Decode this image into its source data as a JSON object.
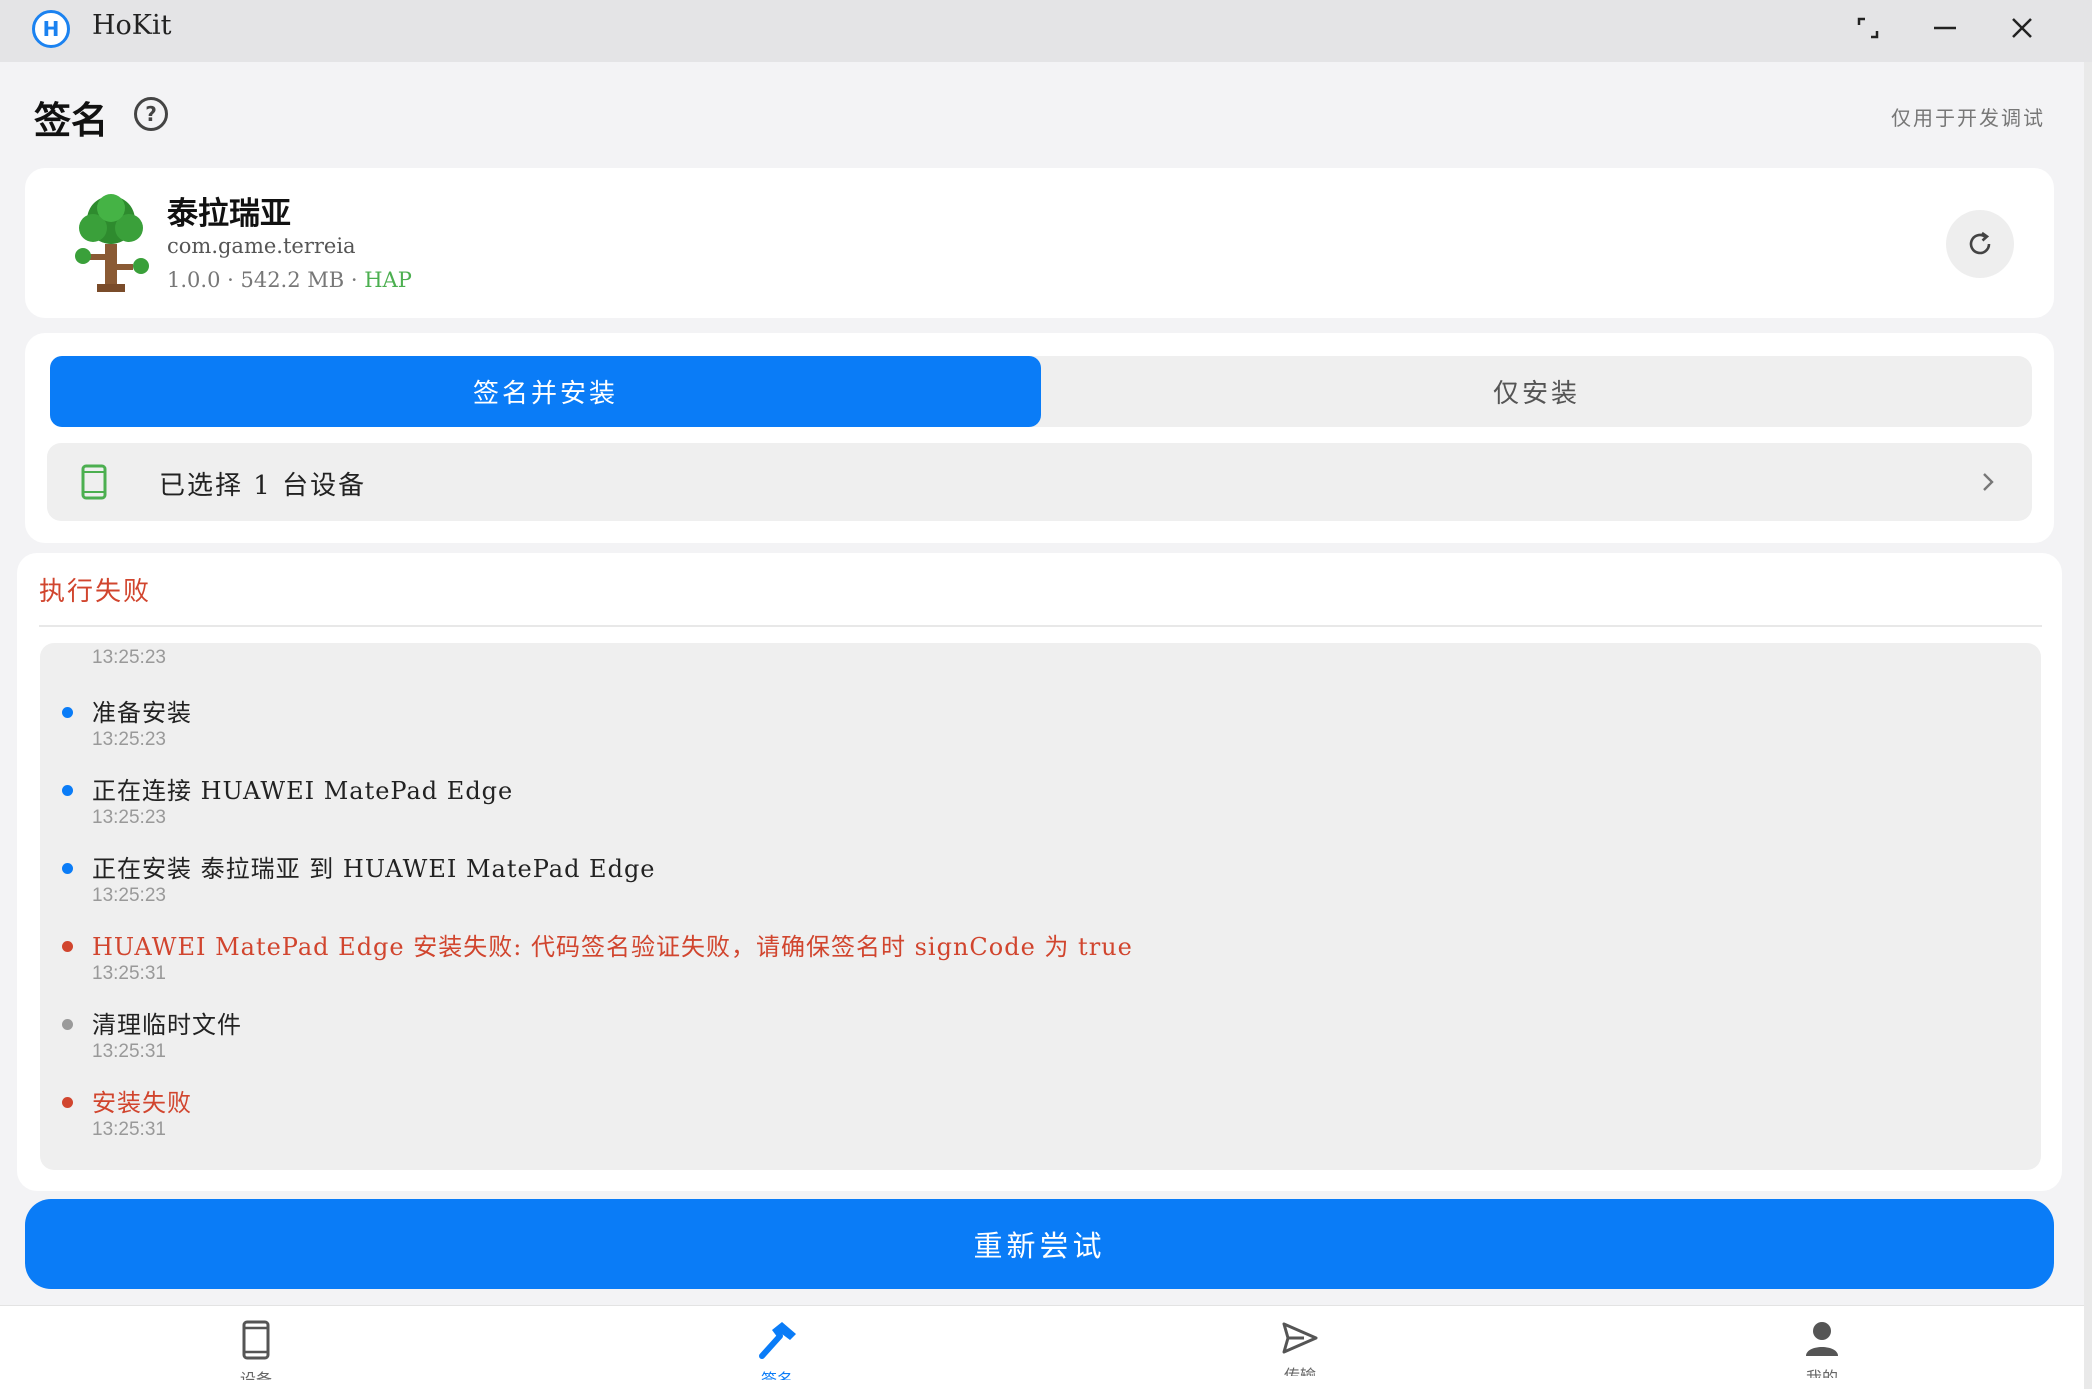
{
  "window": {
    "app_title": "HoKit",
    "logo_letter": "H"
  },
  "header": {
    "title": "签名",
    "help_glyph": "?",
    "dev_note": "仅用于开发调试"
  },
  "app": {
    "name": "泰拉瑞亚",
    "package": "com.game.terreia",
    "version": "1.0.0",
    "size": "542.2 MB",
    "format": "HAP",
    "separator": " · "
  },
  "mode": {
    "sign_install_label": "签名并安装",
    "install_only_label": "仅安装",
    "selected": "sign_install"
  },
  "device": {
    "selected_text": "已选择 1 台设备"
  },
  "log": {
    "status": "执行失败",
    "top_time": "13:25:23",
    "entries": [
      {
        "message": "准备安装",
        "time": "13:25:23",
        "level": "info"
      },
      {
        "message": "正在连接 HUAWEI MatePad Edge",
        "time": "13:25:23",
        "level": "info"
      },
      {
        "message": "正在安装 泰拉瑞亚 到 HUAWEI MatePad Edge",
        "time": "13:25:23",
        "level": "info"
      },
      {
        "message": "HUAWEI MatePad Edge 安装失败: 代码签名验证失败，请确保签名时 signCode 为 true",
        "time": "13:25:31",
        "level": "error"
      },
      {
        "message": "清理临时文件",
        "time": "13:25:31",
        "level": "neutral"
      },
      {
        "message": "安装失败",
        "time": "13:25:31",
        "level": "error"
      }
    ]
  },
  "retry": {
    "label": "重新尝试"
  },
  "nav": {
    "items": [
      {
        "label": "设备",
        "icon": "phone-icon"
      },
      {
        "label": "签名",
        "icon": "hammer-icon",
        "active": true
      },
      {
        "label": "传输",
        "icon": "send-icon"
      },
      {
        "label": "我的",
        "icon": "person-icon"
      }
    ]
  },
  "colors": {
    "accent": "#0a7cf7",
    "error": "#d1452e",
    "success": "#4caf50"
  }
}
